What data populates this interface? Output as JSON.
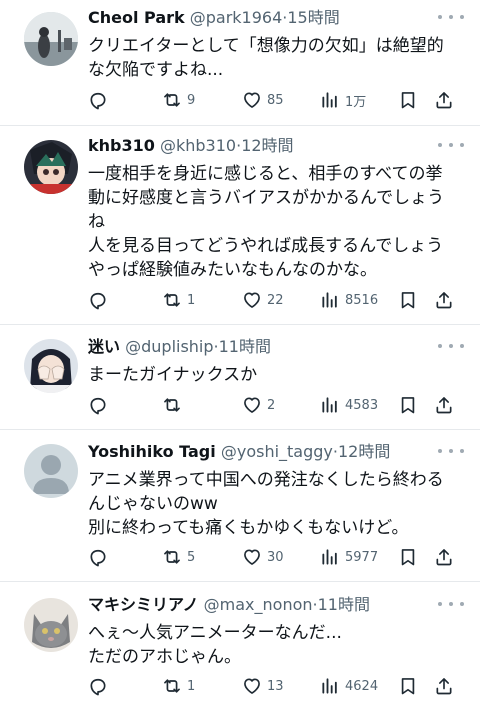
{
  "tweets": [
    {
      "name": "Cheol Park",
      "handle": "@park1964",
      "dot": "·",
      "time": "15時間",
      "text": "クリエイターとして「想像力の欠如」は絶望的\nな欠陥ですよね...",
      "retweets": "9",
      "likes": "85",
      "views": "1万",
      "avatar_icon": "photo-silhouette-by-water"
    },
    {
      "name": "khb310",
      "handle": "@khb310",
      "dot": "·",
      "time": "12時間",
      "text": "一度相手を身近に感じると、相手のすべての挙\n動に好感度と言うバイアスがかかるんでしょう\nね\n人を見る目ってどうやれば成長するんでしょう\nやっぱ経験値みたいなもんなのかな。",
      "retweets": "1",
      "likes": "22",
      "views": "8516",
      "avatar_icon": "anime-character"
    },
    {
      "name": "迷い",
      "handle": "@dupliship",
      "dot": "·",
      "time": "11時間",
      "text": "まーたガイナックスか",
      "retweets": "",
      "likes": "2",
      "views": "4583",
      "avatar_icon": "anime-girl-covering-face"
    },
    {
      "name": "Yoshihiko Tagi",
      "handle": "@yoshi_taggy",
      "dot": "·",
      "time": "12時間",
      "text": "アニメ業界って中国への発注なくしたら終わる\nんじゃないのww\n別に終わっても痛くもかゆくもないけど。",
      "retweets": "5",
      "likes": "30",
      "views": "5977",
      "avatar_icon": "default-person"
    },
    {
      "name": "マキシミリアノ",
      "handle": "@max_nonon",
      "dot": "·",
      "time": "11時間",
      "text": "へぇ～人気アニメーターなんだ...\nただのアホじゃん。",
      "retweets": "1",
      "likes": "13",
      "views": "4624",
      "avatar_icon": "gray-cat"
    }
  ],
  "colors": {
    "text": "#0f1419",
    "muted": "#536471",
    "divider": "#e6e9ec"
  }
}
